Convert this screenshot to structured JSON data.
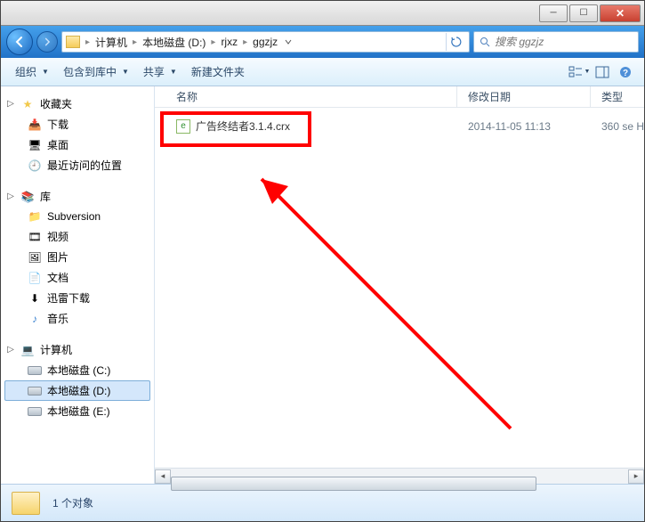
{
  "titlebar": {
    "min": "—",
    "max": "▣",
    "close": "✕"
  },
  "breadcrumb": {
    "segments": [
      "计算机",
      "本地磁盘 (D:)",
      "rjxz",
      "ggzjz"
    ]
  },
  "search": {
    "placeholder": "搜索 ggzjz"
  },
  "toolbar": {
    "organize": "组织",
    "include": "包含到库中",
    "share": "共享",
    "newfolder": "新建文件夹"
  },
  "sidebar": {
    "favorites": {
      "label": "收藏夹",
      "items": [
        "下载",
        "桌面",
        "最近访问的位置"
      ]
    },
    "library": {
      "label": "库",
      "items": [
        "Subversion",
        "视频",
        "图片",
        "文档",
        "迅雷下载",
        "音乐"
      ]
    },
    "computer": {
      "label": "计算机",
      "items": [
        "本地磁盘 (C:)",
        "本地磁盘 (D:)",
        "本地磁盘 (E:)"
      ],
      "selected": 1
    }
  },
  "columns": {
    "name": "名称",
    "date": "修改日期",
    "type": "类型"
  },
  "files": [
    {
      "name": "广告终结者3.1.4.crx",
      "date": "2014-11-05 11:13",
      "type": "360 se H"
    }
  ],
  "status": {
    "count": "1 个对象"
  }
}
